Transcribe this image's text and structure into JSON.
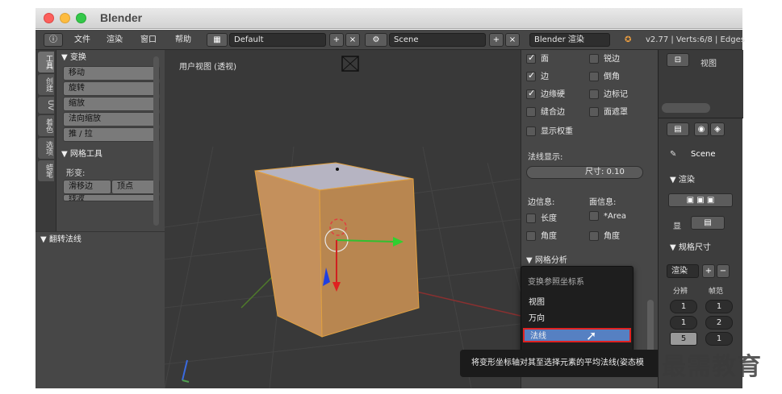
{
  "window": {
    "app_title": "Blender"
  },
  "header": {
    "menus": [
      "文件",
      "渲染",
      "窗口",
      "帮助"
    ],
    "screen_layout": "Default",
    "scene": "Scene",
    "render_engine": "Blender 渲染",
    "stats": "v2.77 | Verts:6/8 | Edges"
  },
  "toolshelf": {
    "tabs": [
      "工具",
      "创建",
      "UV",
      "着色",
      "选项",
      "蜡笔"
    ],
    "transform_header": "▼ 变换",
    "transform_buttons": [
      "移动",
      "旋转",
      "缩放",
      "法向缩放",
      "推 / 拉"
    ],
    "mesh_tools_header": "▼ 网格工具",
    "deform_label": "形变:",
    "slide_edge": "滑移边",
    "vertex": "顶点",
    "more": "线波",
    "flip_normals_header": "▼ 翻转法线"
  },
  "viewport": {
    "label": "用户视图 (透视)"
  },
  "properties": {
    "col1": [
      "面",
      "边",
      "边缘硬",
      "缝合边",
      "显示权重"
    ],
    "col1_checked": [
      true,
      true,
      true,
      false,
      false
    ],
    "col2": [
      "锐边",
      "倒角",
      "边标记",
      "面遮罩"
    ],
    "normals_label": "法线显示:",
    "size_label": "尺寸: 0.10",
    "edge_info": "边信息:",
    "face_info": "面信息:",
    "length": "长度",
    "area": "*Area",
    "angle1": "角度",
    "angle2": "角度",
    "mesh_analysis": "▼ 网格分析"
  },
  "menu": {
    "title": "变换参照坐标系",
    "items": [
      "视图",
      "万向",
      "法线"
    ],
    "selected_index": 2
  },
  "tooltip": {
    "text": "将变形坐标轴对其至选择元素的平均法线(姿态模"
  },
  "right_panel": {
    "view_label": "视图",
    "scene": "Scene",
    "render_header": "▼ 渲染",
    "display_label": "显",
    "dimensions_header": "▼ 规格尺寸",
    "render_preset": "渲染",
    "resolution": "分辨",
    "frame_range": "帧范",
    "values": [
      "1",
      "1",
      "1",
      "2",
      "5",
      "1"
    ]
  },
  "watermark": "最需教育",
  "colors": {
    "selection_blue": "#5680c2",
    "highlight_red": "#e02222",
    "cube_face": "#c8925e"
  }
}
